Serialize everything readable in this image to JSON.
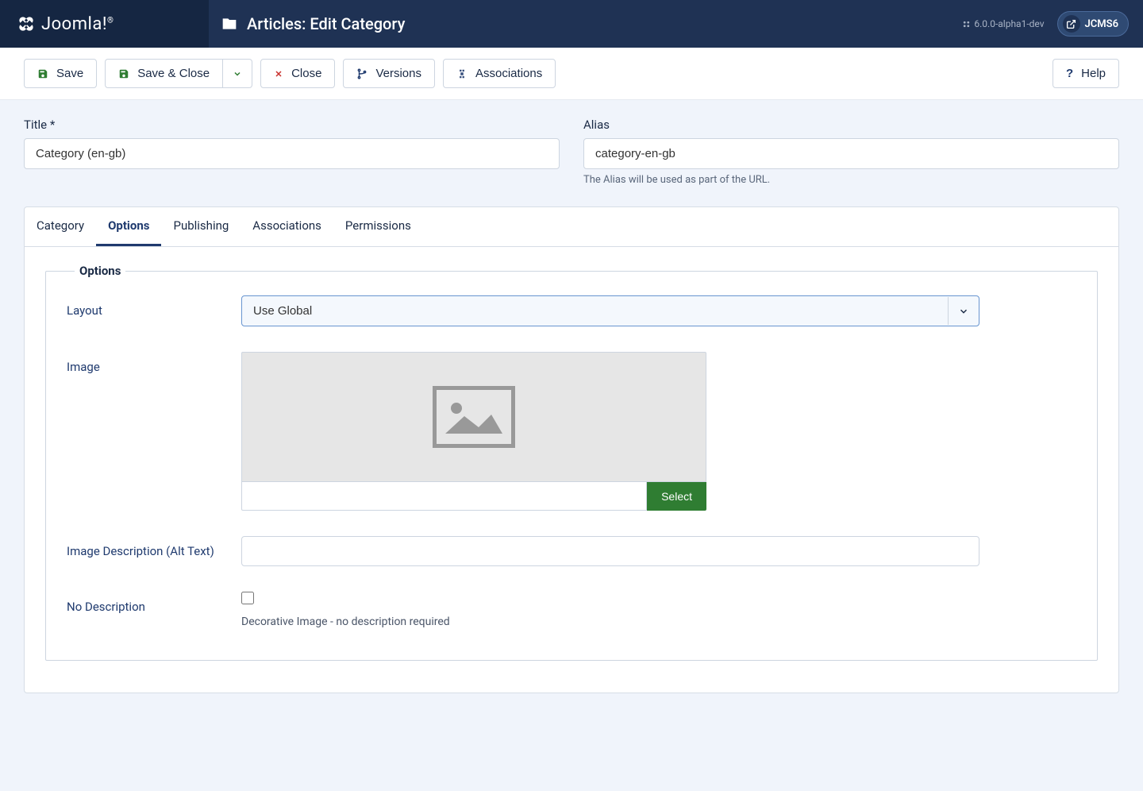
{
  "brand": "Joomla!",
  "pageTitle": "Articles: Edit Category",
  "version": "6.0.0-alpha1-dev",
  "user": "JCMS6",
  "toolbar": {
    "save": "Save",
    "saveClose": "Save & Close",
    "close": "Close",
    "versions": "Versions",
    "associations": "Associations",
    "help": "Help"
  },
  "fields": {
    "titleLabel": "Title *",
    "titleValue": "Category (en-gb)",
    "aliasLabel": "Alias",
    "aliasValue": "category-en-gb",
    "aliasHint": "The Alias will be used as part of the URL."
  },
  "tabs": [
    "Category",
    "Options",
    "Publishing",
    "Associations",
    "Permissions"
  ],
  "activeTab": 1,
  "options": {
    "legend": "Options",
    "layoutLabel": "Layout",
    "layoutValue": "Use Global",
    "imageLabel": "Image",
    "imageSelect": "Select",
    "altLabel": "Image Description (Alt Text)",
    "altValue": "",
    "noDescLabel": "No Description",
    "noDescHint": "Decorative Image - no description required"
  }
}
